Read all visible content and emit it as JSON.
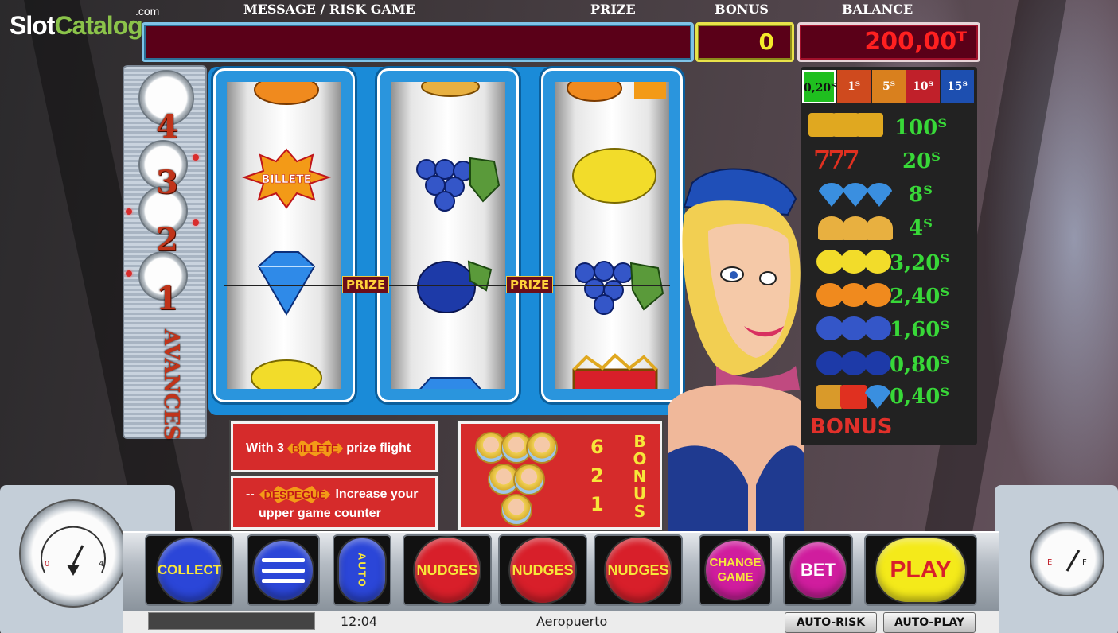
{
  "brand": {
    "main": "Slot",
    "accent": "Catalog",
    "suffix": ".com"
  },
  "header": {
    "message_label": "MESSAGE / RISK GAME",
    "prize_label": "PRIZE",
    "bonus_label": "BONUS",
    "balance_label": "BALANCE",
    "bonus_value": "0",
    "balance_value": "200,00ᵀ"
  },
  "advances": {
    "numbers": [
      "4",
      "3",
      "2",
      "1"
    ],
    "label": "AVANCES"
  },
  "reels": {
    "prize_tag": "PRIZE",
    "reel1": [
      "orange",
      "billete",
      "diamond",
      "lemon"
    ],
    "reel2": [
      "bell",
      "grapes",
      "plum",
      "diamond"
    ],
    "reel3": [
      "orange",
      "grapes",
      "lemon",
      "crown"
    ],
    "billete_text": "BILLETE"
  },
  "info": {
    "line1_pre": "With 3",
    "line1_burst": "BILLETE",
    "line1_post": "prize flight",
    "line2_pre": "--",
    "line2_burst": "DESPEGUE",
    "line2_post": "Increase your",
    "line2_sub": "upper game counter"
  },
  "bonus_info": {
    "counts": [
      "6",
      "2",
      "1"
    ],
    "label": "BONUS"
  },
  "stakes": [
    {
      "label": "0,20ᵀ",
      "color": "#1fbf1f",
      "selected": true
    },
    {
      "label": "1ᵀ",
      "color": "#cf4a1e"
    },
    {
      "label": "5ᵀ",
      "color": "#d9801e"
    },
    {
      "label": "10ᵀ",
      "color": "#c0202a"
    },
    {
      "label": "15ᵀ",
      "color": "#1d4fb0"
    }
  ],
  "paytable": [
    {
      "icon": "crown-icon",
      "color": "#e0a820",
      "value": "100ᵀ"
    },
    {
      "icon": "seven-icon",
      "color": "#e03020",
      "value": "20ᵀ"
    },
    {
      "icon": "diamond-icon",
      "color": "#3a8fe0",
      "value": "8ᵀ"
    },
    {
      "icon": "bell-icon",
      "color": "#e8b040",
      "value": "4ᵀ"
    },
    {
      "icon": "lemon-icon",
      "color": "#f2dc2a",
      "value": "3,20ᵀ"
    },
    {
      "icon": "orange-icon",
      "color": "#f08a1e",
      "value": "2,40ᵀ"
    },
    {
      "icon": "grapes-icon",
      "color": "#3456c8",
      "value": "1,60ᵀ"
    },
    {
      "icon": "plum-icon",
      "color": "#1d3aa8",
      "value": "0,80ᵀ"
    },
    {
      "icon": "mixed-icon",
      "color": "#d99a2a",
      "value": "0,40ᵀ"
    }
  ],
  "paytable_bonus": "BONUS",
  "buttons": {
    "collect": "COLLECT",
    "auto": "AUTO",
    "nudges": "NUDGES",
    "change_game": "CHANGE GAME",
    "bet": "BET",
    "play": "PLAY",
    "auto_risk": "AUTO-RISK",
    "auto_play": "AUTO-PLAY"
  },
  "status": {
    "time": "12:04",
    "game_name": "Aeropuerto"
  },
  "colors": {
    "collect": "#2b46d8",
    "menu": "#2b46d8",
    "auto": "#2b46d8",
    "nudges": "#d81f2a",
    "change_game": "#d01d9e",
    "bet": "#d01d9e",
    "play": "#f4ea1a",
    "play_text": "#d81f2a"
  }
}
